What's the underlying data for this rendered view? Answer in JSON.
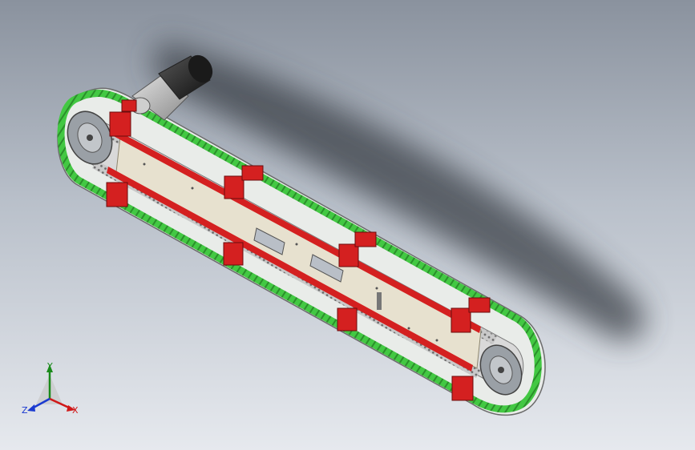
{
  "viewport": {
    "background_top": "#8a929e",
    "background_bottom": "#e6e9ee"
  },
  "model": {
    "belt_color": "#3cc43c",
    "bracket_color": "#d42020",
    "frame_color": "#e7e1cf",
    "pulley_color": "#9aa0a6",
    "motor_color": "#2a2a2a",
    "gearbox_color": "#b7b7b7",
    "shadow_color": "#3a3f46"
  },
  "triad": {
    "y_label": "Y",
    "x_label": "X",
    "z_label": "Z",
    "y_color": "#1a8a1a",
    "x_color": "#d01818",
    "z_color": "#1a3ad0"
  }
}
